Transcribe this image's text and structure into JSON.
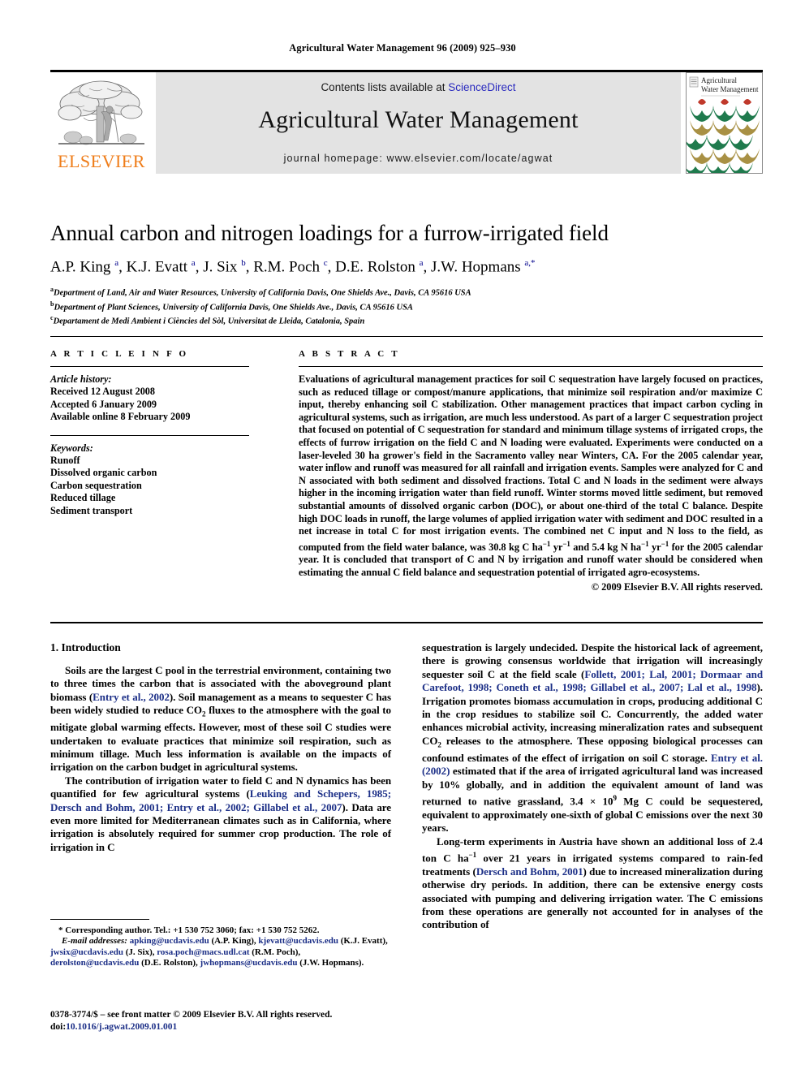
{
  "running_head": "Agricultural Water Management 96 (2009) 925–930",
  "masthead": {
    "publisher_logo_label": "ELSEVIER",
    "contents_prefix": "Contents lists available at ",
    "contents_link": "ScienceDirect",
    "journal_title": "Agricultural Water Management",
    "homepage": "journal homepage: www.elsevier.com/locate/agwat",
    "cover_title_line1": "Agricultural",
    "cover_title_line2": "Water Management",
    "colors": {
      "elsevier_orange": "#ef7d1a",
      "link_blue": "#2b2bbf",
      "citation_blue": "#1c2f87",
      "banner_gray": "#e3e3e3",
      "cover_green": "#1f7a4d",
      "cover_olive": "#a89044",
      "cover_red": "#c0392b"
    }
  },
  "article": {
    "title": "Annual carbon and nitrogen loadings for a furrow-irrigated field",
    "authors_html": "A.P. King <sup>a</sup>, K.J. Evatt <sup>a</sup>, J. Six <sup>b</sup>, R.M. Poch <sup>c</sup>, D.E. Rolston <sup>a</sup>, J.W. Hopmans <sup>a,*</sup>",
    "affiliations": [
      {
        "marker": "a",
        "text": "Department of Land, Air and Water Resources, University of California Davis, One Shields Ave., Davis, CA 95616 USA"
      },
      {
        "marker": "b",
        "text": "Department of Plant Sciences, University of California Davis, One Shields Ave., Davis, CA 95616 USA"
      },
      {
        "marker": "c",
        "text": "Departament de Medi Ambient i Ciències del Sòl, Universitat de Lleida, Catalonia, Spain"
      }
    ]
  },
  "article_info": {
    "heading": "A R T I C L E   I N F O",
    "history_label": "Article history:",
    "history": [
      "Received 12 August 2008",
      "Accepted 6 January 2009",
      "Available online 8 February 2009"
    ],
    "keywords_label": "Keywords:",
    "keywords": [
      "Runoff",
      "Dissolved organic carbon",
      "Carbon sequestration",
      "Reduced tillage",
      "Sediment transport"
    ]
  },
  "abstract": {
    "heading": "A B S T R A C T",
    "text_html": "Evaluations of agricultural management practices for soil C sequestration have largely focused on practices, such as reduced tillage or compost/manure applications, that minimize soil respiration and/or maximize C input, thereby enhancing soil C stabilization. Other management practices that impact carbon cycling in agricultural systems, such as irrigation, are much less understood. As part of a larger C sequestration project that focused on potential of C sequestration for standard and minimum tillage systems of irrigated crops, the effects of furrow irrigation on the field C and N loading were evaluated. Experiments were conducted on a laser-leveled 30 ha grower's field in the Sacramento valley near Winters, CA. For the 2005 calendar year, water inflow and runoff was measured for all rainfall and irrigation events. Samples were analyzed for C and N associated with both sediment and dissolved fractions. Total C and N loads in the sediment were always higher in the incoming irrigation water than field runoff. Winter storms moved little sediment, but removed substantial amounts of dissolved organic carbon (DOC), or about one-third of the total C balance. Despite high DOC loads in runoff, the large volumes of applied irrigation water with sediment and DOC resulted in a net increase in total C for most irrigation events. The combined net C input and N loss to the field, as computed from the field water balance, was 30.8 kg C ha<sup>&#8722;1</sup> yr<sup>&#8722;1</sup> and 5.4 kg N ha<sup>&#8722;1</sup> yr<sup>&#8722;1</sup> for the 2005 calendar year. It is concluded that transport of C and N by irrigation and runoff water should be considered when estimating the annual C field balance and sequestration potential of irrigated agro-ecosystems.",
    "copyright": "© 2009 Elsevier B.V. All rights reserved."
  },
  "body": {
    "section_heading": "1. Introduction",
    "left_paragraphs_html": [
      "Soils are the largest C pool in the terrestrial environment, containing two to three times the carbon that is associated with the aboveground plant biomass (<span class=\"ref\">Entry et al., 2002</span>). Soil management as a means to sequester C has been widely studied to reduce CO<sub>2</sub> fluxes to the atmosphere with the goal to mitigate global warming effects. However, most of these soil C studies were undertaken to evaluate practices that minimize soil respiration, such as minimum tillage. Much less information is available on the impacts of irrigation on the carbon budget in agricultural systems.",
      "The contribution of irrigation water to field C and N dynamics has been quantified for few agricultural systems (<span class=\"ref\">Leuking and Schepers, 1985; Dersch and Bohm, 2001; Entry et al., 2002; Gillabel et al., 2007</span>). Data are even more limited for Mediterranean climates such as in California, where irrigation is absolutely required for summer crop production. The role of irrigation in C"
    ],
    "right_paragraphs_html": [
      "sequestration is largely undecided. Despite the historical lack of agreement, there is growing consensus worldwide that irrigation will increasingly sequester soil C at the field scale (<span class=\"ref\">Follett, 2001; Lal, 2001; Dormaar and Carefoot, 1998; Coneth et al., 1998; Gillabel et al., 2007; Lal et al., 1998</span>). Irrigation promotes biomass accumulation in crops, producing additional C in the crop residues to stabilize soil C. Concurrently, the added water enhances microbial activity, increasing mineralization rates and subsequent CO<sub>2</sub> releases to the atmosphere. These opposing biological processes can confound estimates of the effect of irrigation on soil C storage. <span class=\"ref\">Entry et al. (2002)</span> estimated that if the area of irrigated agricultural land was increased by 10% globally, and in addition the equivalent amount of land was returned to native grassland, 3.4 &#215; 10<sup>9</sup> Mg C could be sequestered, equivalent to approximately one-sixth of global C emissions over the next 30 years.",
      "Long-term experiments in Austria have shown an additional loss of 2.4 ton C ha<sup>&#8722;1</sup> over 21 years in irrigated systems compared to rain-fed treatments (<span class=\"ref\">Dersch and Bohm, 2001</span>) due to increased mineralization during otherwise dry periods. In addition, there can be extensive energy costs associated with pumping and delivering irrigation water. The C emissions from these operations are generally not accounted for in analyses of the contribution of"
    ]
  },
  "footnotes": {
    "corresponding_html": "* Corresponding author. Tel.: +1 530 752 3060; fax: +1 530 752 5262.",
    "emails_html": "<span class=\"ital\">E-mail addresses:</span> <span class=\"em\">apking@ucdavis.edu</span> (A.P. King), <span class=\"em\">kjevatt@ucdavis.edu</span> (K.J. Evatt), <span class=\"em\">jwsix@ucdavis.edu</span> (J. Six), <span class=\"em\">rosa.poch@macs.udl.cat</span> (R.M. Poch), <span class=\"em\">derolston@ucdavis.edu</span> (D.E. Rolston), <span class=\"em\">jwhopmans@ucdavis.edu</span> (J.W. Hopmans)."
  },
  "imprint": {
    "front_matter": "0378-3774/$ – see front matter © 2009 Elsevier B.V. All rights reserved.",
    "doi_prefix": "doi:",
    "doi": "10.1016/j.agwat.2009.01.001"
  }
}
